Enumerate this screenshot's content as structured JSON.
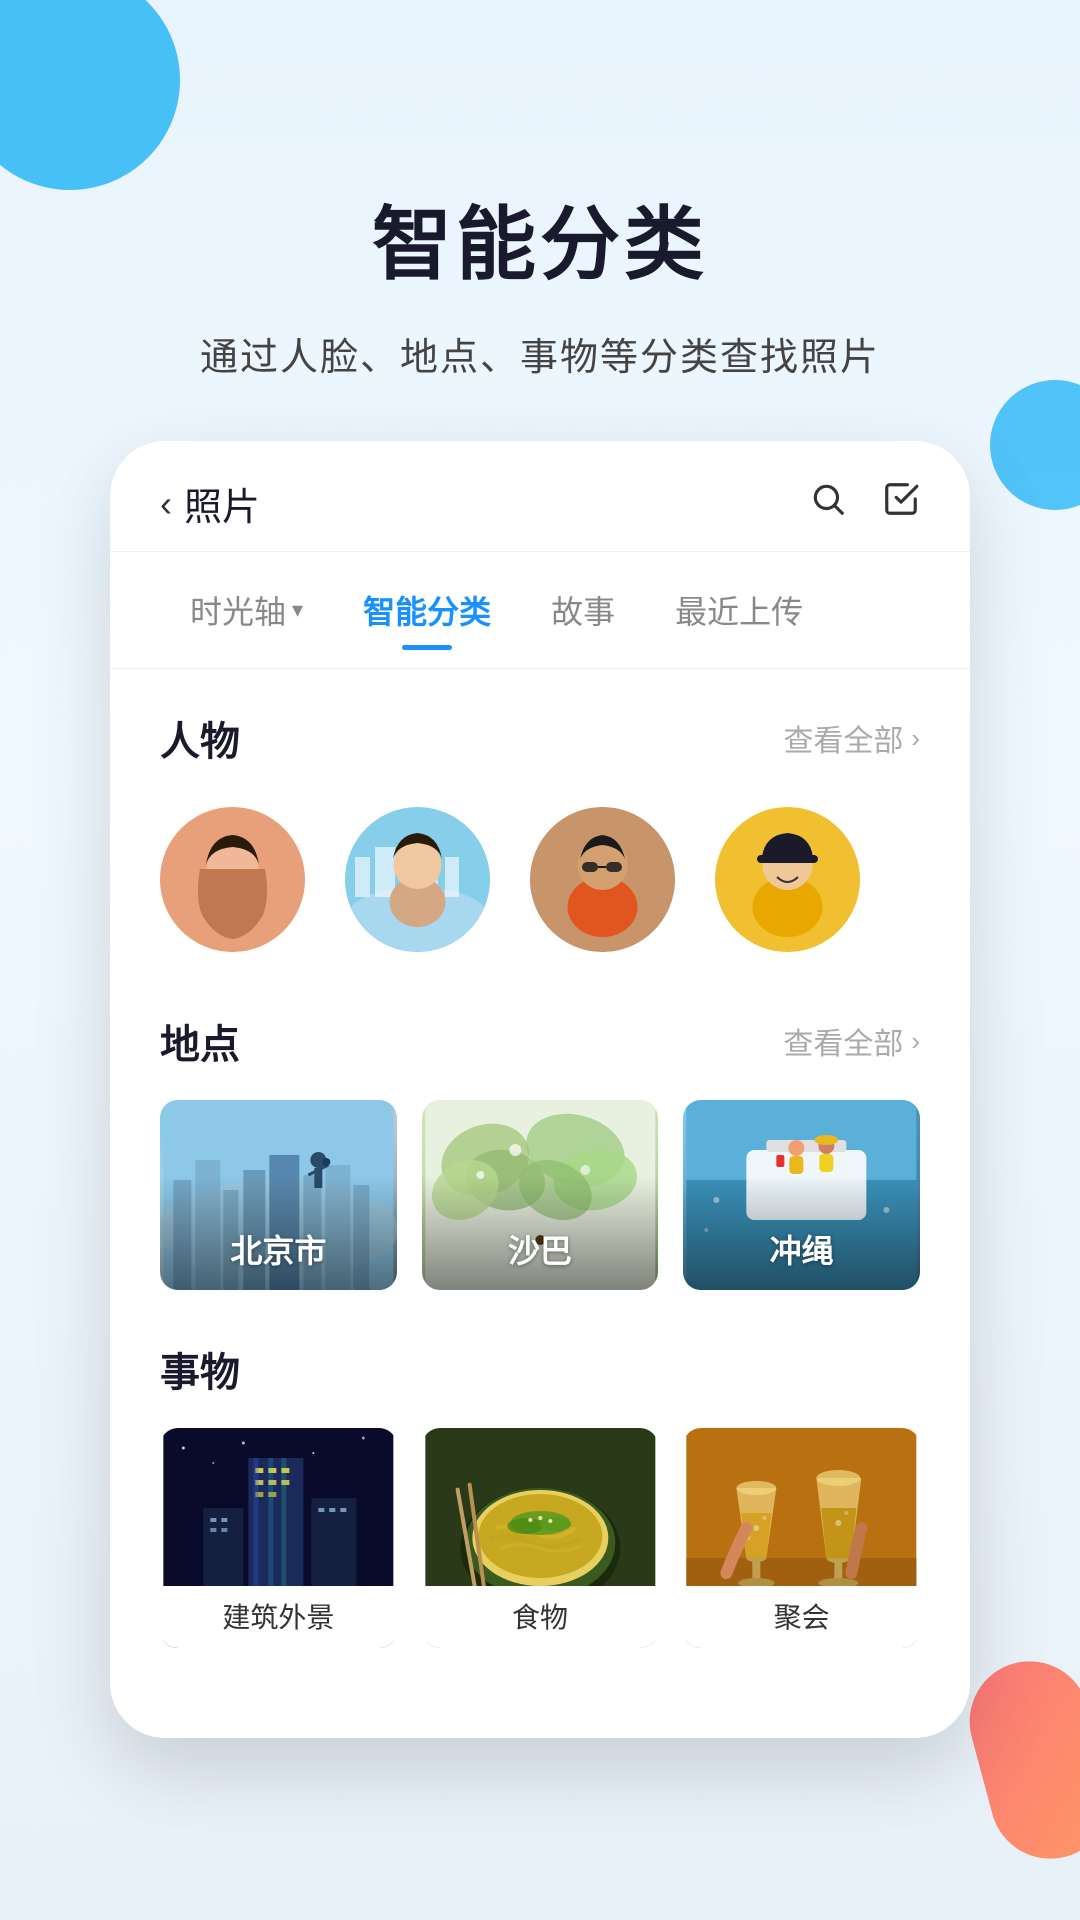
{
  "page": {
    "background": "#e8f4fd"
  },
  "header": {
    "main_title": "智能分类",
    "sub_title": "通过人脸、地点、事物等分类查找照片"
  },
  "phone": {
    "topbar": {
      "back_label": "照片",
      "search_icon": "search",
      "check_icon": "check-square"
    },
    "tabs": [
      {
        "label": "时光轴",
        "dropdown": true,
        "active": false
      },
      {
        "label": "智能分类",
        "dropdown": false,
        "active": true
      },
      {
        "label": "故事",
        "dropdown": false,
        "active": false
      },
      {
        "label": "最近上传",
        "dropdown": false,
        "active": false
      }
    ],
    "sections": [
      {
        "id": "people",
        "title": "人物",
        "view_all": "查看全部",
        "items": [
          {
            "id": 1,
            "color_class": "avatar-1"
          },
          {
            "id": 2,
            "color_class": "avatar-2"
          },
          {
            "id": 3,
            "color_class": "avatar-3"
          },
          {
            "id": 4,
            "color_class": "avatar-4"
          }
        ]
      },
      {
        "id": "places",
        "title": "地点",
        "view_all": "查看全部",
        "items": [
          {
            "id": 1,
            "label": "北京市",
            "color_class": "place-bg-1"
          },
          {
            "id": 2,
            "label": "沙巴",
            "color_class": "place-bg-2"
          },
          {
            "id": 3,
            "label": "冲绳",
            "color_class": "place-bg-3"
          }
        ]
      },
      {
        "id": "things",
        "title": "事物",
        "items": [
          {
            "id": 1,
            "label": "建筑外景",
            "color_class": "thing-bg-1"
          },
          {
            "id": 2,
            "label": "食物",
            "color_class": "thing-bg-2"
          },
          {
            "id": 3,
            "label": "聚会",
            "color_class": "thing-bg-3"
          }
        ]
      }
    ]
  }
}
